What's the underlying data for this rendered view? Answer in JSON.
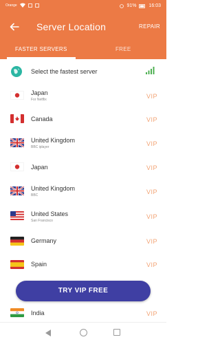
{
  "status_bar": {
    "carrier": "Orange",
    "battery": "91%",
    "time": "16:03"
  },
  "app_bar": {
    "back_icon": "arrow-left-icon",
    "title": "Server Location",
    "repair_label": "REPAIR"
  },
  "tabs": [
    {
      "label": "FASTER SERVERS",
      "selected": true
    },
    {
      "label": "FREE",
      "selected": false
    }
  ],
  "fastest": {
    "label": "Select the fastest server",
    "icon": "globe-icon",
    "signal_icon": "signal-bars-icon",
    "signal_color": "#4caf50"
  },
  "servers": [
    {
      "name": "Japan",
      "sub": "For Netflix",
      "vip": "VIP",
      "flag": "jp"
    },
    {
      "name": "Canada",
      "sub": "",
      "vip": "VIP",
      "flag": "ca"
    },
    {
      "name": "United Kingdom",
      "sub": "BBC iplayer",
      "vip": "VIP",
      "flag": "uk"
    },
    {
      "name": "Japan",
      "sub": "",
      "vip": "VIP",
      "flag": "jp"
    },
    {
      "name": "United Kingdom",
      "sub": "BBC",
      "vip": "VIP",
      "flag": "uk"
    },
    {
      "name": "United States",
      "sub": "San Francisco",
      "vip": "VIP",
      "flag": "us"
    },
    {
      "name": "Germany",
      "sub": "",
      "vip": "VIP",
      "flag": "de"
    },
    {
      "name": "Spain",
      "sub": "",
      "vip": "VIP",
      "flag": "es"
    },
    {
      "name": "India",
      "sub": "",
      "vip": "VIP",
      "flag": "in"
    }
  ],
  "vip_button_label": "TRY VIP FREE",
  "colors": {
    "accent": "#ec7a45",
    "vip_text": "#f2a273",
    "button": "#3f3fa3"
  }
}
